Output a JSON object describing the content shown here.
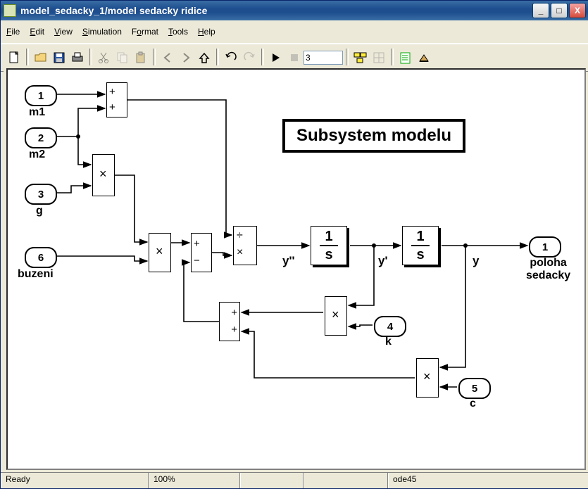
{
  "window": {
    "title": "model_sedacky_1/model sedacky ridice"
  },
  "menu": {
    "file": "File",
    "edit": "Edit",
    "view": "View",
    "sim": "Simulation",
    "format": "Format",
    "tools": "Tools",
    "help": "Help"
  },
  "toolbar": {
    "stop_time": "3"
  },
  "status": {
    "ready": "Ready",
    "zoom": "100%",
    "solver": "ode45"
  },
  "diagram": {
    "title": "Subsystem modelu",
    "ports_in": {
      "m1": {
        "num": "1",
        "label": "m1"
      },
      "m2": {
        "num": "2",
        "label": "m2"
      },
      "g": {
        "num": "3",
        "label": "g"
      },
      "buzeni": {
        "num": "6",
        "label": "buzeni"
      },
      "k": {
        "num": "4",
        "label": "k"
      },
      "c": {
        "num": "5",
        "label": "c"
      }
    },
    "ports_out": {
      "poloha": {
        "num": "1",
        "label1": "poloha",
        "label2": "sedacky"
      }
    },
    "signals": {
      "ypp": "y''",
      "yp": "y'",
      "y": "y"
    },
    "ops": {
      "plus": "+",
      "minus": "−",
      "times": "×",
      "div": "÷"
    },
    "tf": {
      "num": "1",
      "den": "s"
    }
  }
}
